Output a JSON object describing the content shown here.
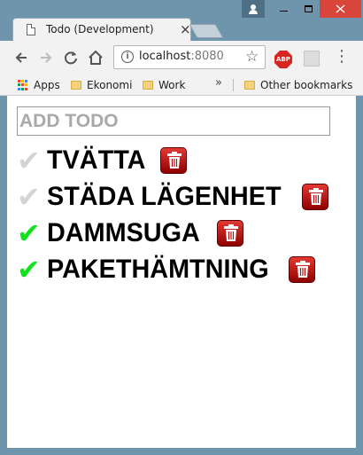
{
  "browser": {
    "tab_title": "Todo (Development)",
    "tab_close": "×",
    "url_host": "localhost",
    "url_port": ":8080",
    "abp_label": "ABP",
    "bookmarks": {
      "apps": "Apps",
      "items": [
        "Ekonomi",
        "Work"
      ],
      "overflow": "»",
      "other": "Other bookmarks"
    }
  },
  "app": {
    "add_placeholder": "ADD TODO",
    "todos": [
      {
        "text": "TVÄTTA",
        "done": false
      },
      {
        "text": "STÄDA LÄGENHET",
        "done": false
      },
      {
        "text": "DAMMSUGA",
        "done": true
      },
      {
        "text": "PAKETHÄMTNING",
        "done": true
      }
    ],
    "check_glyph": "✔",
    "colors": {
      "done_check": "#11e21c",
      "pending_check": "#d4d4d4",
      "delete_button": "#c8201a"
    },
    "icons": {
      "delete": "trash-icon",
      "toggle": "check-icon"
    }
  }
}
